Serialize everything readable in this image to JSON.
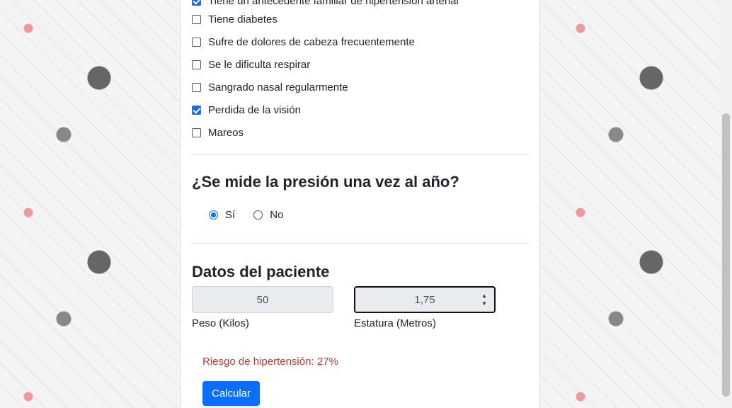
{
  "symptoms": [
    {
      "label": "Tiene un antecedente familiar de hipertensión arterial",
      "checked": true
    },
    {
      "label": "Tiene diabetes",
      "checked": false
    },
    {
      "label": "Sufre de dolores de cabeza frecuentemente",
      "checked": false
    },
    {
      "label": "Se le dificulta respirar",
      "checked": false
    },
    {
      "label": "Sangrado nasal regularmente",
      "checked": false
    },
    {
      "label": "Perdida de la visión",
      "checked": true
    },
    {
      "label": "Mareos",
      "checked": false
    }
  ],
  "pressure_question": {
    "title": "¿Se mide la presión una vez al año?",
    "options": [
      "Sí",
      "No"
    ],
    "selected": "Sí"
  },
  "patient": {
    "title": "Datos del paciente",
    "weight_value": "50",
    "weight_label": "Peso (Kilos)",
    "height_value": "1,75",
    "height_label": "Estatura (Metros)"
  },
  "result": {
    "text": "Riesgo de hipertensión: 27%"
  },
  "actions": {
    "calculate_label": "Calcular"
  },
  "colors": {
    "accent": "#0d6efd",
    "risk": "#c0392b"
  }
}
